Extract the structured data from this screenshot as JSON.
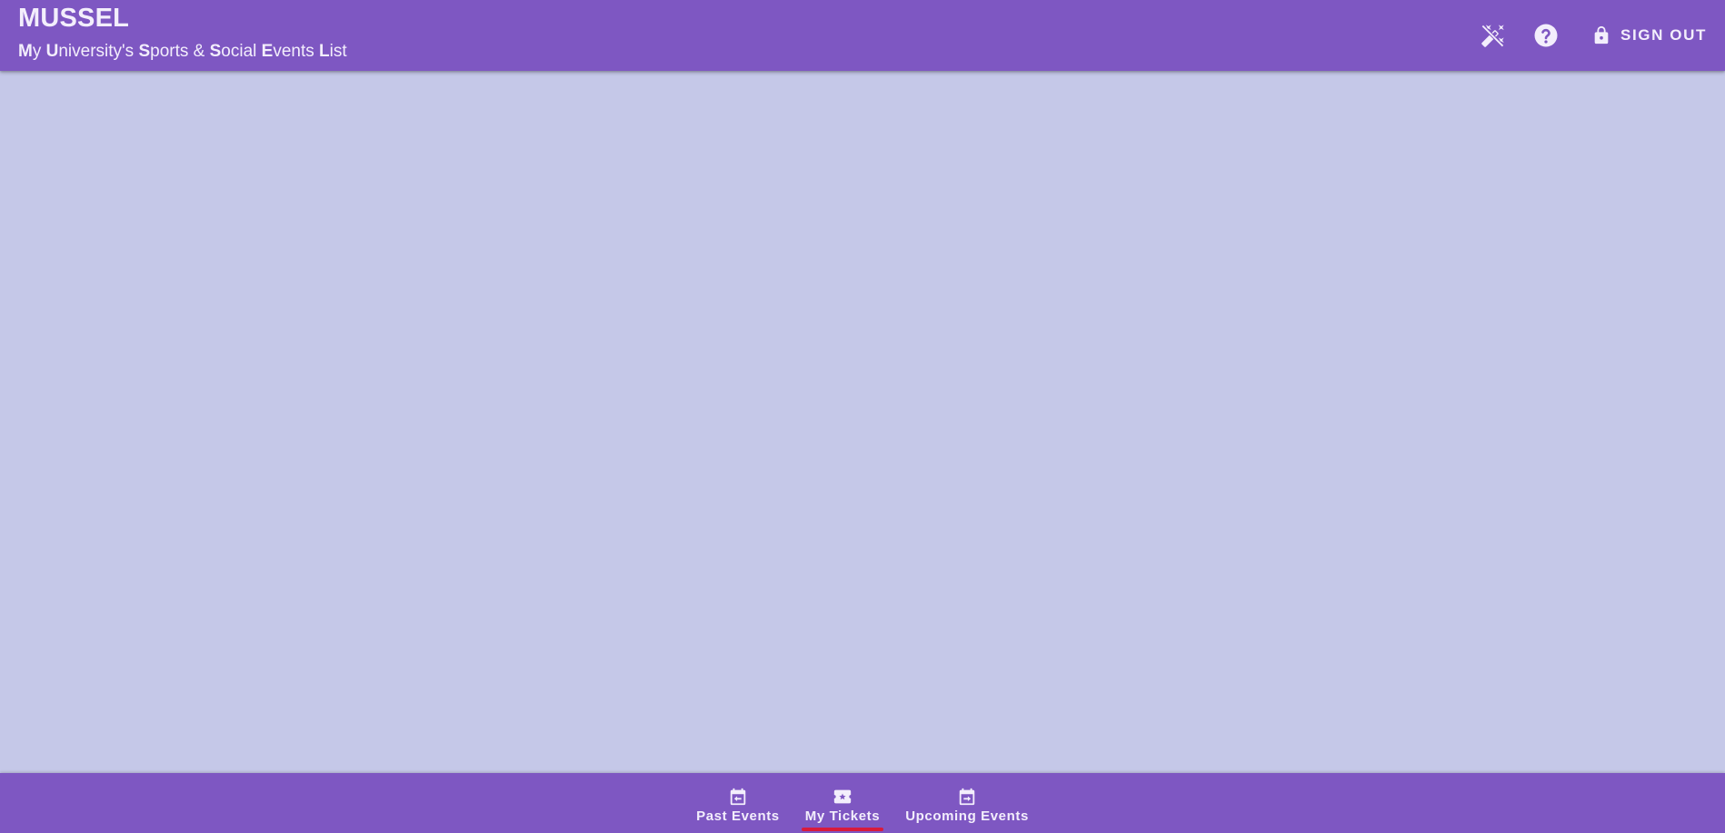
{
  "app": {
    "title": "MUSSEL",
    "subtitle_parts": [
      {
        "text": "M",
        "bold": true
      },
      {
        "text": "y ",
        "bold": false
      },
      {
        "text": "U",
        "bold": true
      },
      {
        "text": "niversity's ",
        "bold": false
      },
      {
        "text": "S",
        "bold": true
      },
      {
        "text": "ports & ",
        "bold": false
      },
      {
        "text": "S",
        "bold": true
      },
      {
        "text": "ocial ",
        "bold": false
      },
      {
        "text": "E",
        "bold": true
      },
      {
        "text": "vents ",
        "bold": false
      },
      {
        "text": "L",
        "bold": true
      },
      {
        "text": "ist",
        "bold": false
      }
    ]
  },
  "toolbar": {
    "theme_icon": "magic-wand-off-icon",
    "help_icon": "help-circle-icon",
    "signout_icon": "lock-icon",
    "signout_label": "SIGN OUT"
  },
  "bottom_nav": {
    "items": [
      {
        "label": "Past Events",
        "icon": "calendar-arrow-left-icon",
        "active": false
      },
      {
        "label": "My Tickets",
        "icon": "ticket-star-icon",
        "active": true
      },
      {
        "label": "Upcoming Events",
        "icon": "calendar-arrow-right-icon",
        "active": false
      }
    ]
  },
  "colors": {
    "primary": "#7e57c2",
    "background": "#c5c8e8",
    "active_indicator": "#d81b3c",
    "on_primary": "#f3eefc"
  }
}
